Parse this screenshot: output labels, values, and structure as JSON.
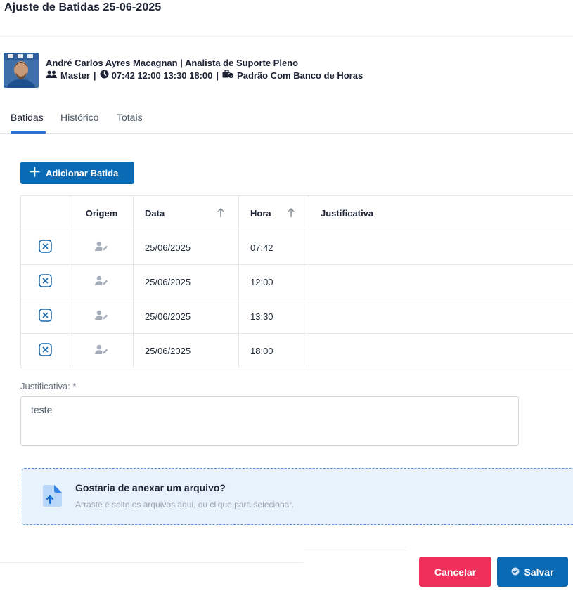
{
  "modal": {
    "title": "Ajuste de Batidas 25-06-2025"
  },
  "employee": {
    "name_role": "André Carlos Ayres Macagnan | Analista de Suporte Pleno",
    "group": "Master",
    "schedule": "07:42 12:00 13:30 18:00",
    "policy": "Padrão Com Banco de Horas"
  },
  "tabs": [
    {
      "label": "Batidas",
      "active": true
    },
    {
      "label": "Histórico",
      "active": false
    },
    {
      "label": "Totais",
      "active": false
    }
  ],
  "add_button": {
    "label": "Adicionar Batida"
  },
  "table": {
    "headers": [
      "",
      "Origem",
      "Data",
      "Hora",
      "Justificativa"
    ],
    "rows": [
      {
        "data": "25/06/2025",
        "hora": "07:42",
        "justificativa": ""
      },
      {
        "data": "25/06/2025",
        "hora": "12:00",
        "justificativa": ""
      },
      {
        "data": "25/06/2025",
        "hora": "13:30",
        "justificativa": ""
      },
      {
        "data": "25/06/2025",
        "hora": "18:00",
        "justificativa": ""
      }
    ]
  },
  "justificativa": {
    "label": "Justificativa: *",
    "value": "teste"
  },
  "upload": {
    "title": "Gostaria de anexar um arquivo?",
    "subtitle": "Arraste e solte os arquivos aqui, ou clique para selecionar."
  },
  "footer": {
    "cancel_label": "Cancelar",
    "save_label": "Salvar"
  },
  "colors": {
    "primary": "#0b6ab4",
    "danger": "#f0305a",
    "tab_accent": "#2f6fd6",
    "dropzone_bg": "#e8f2fd"
  }
}
